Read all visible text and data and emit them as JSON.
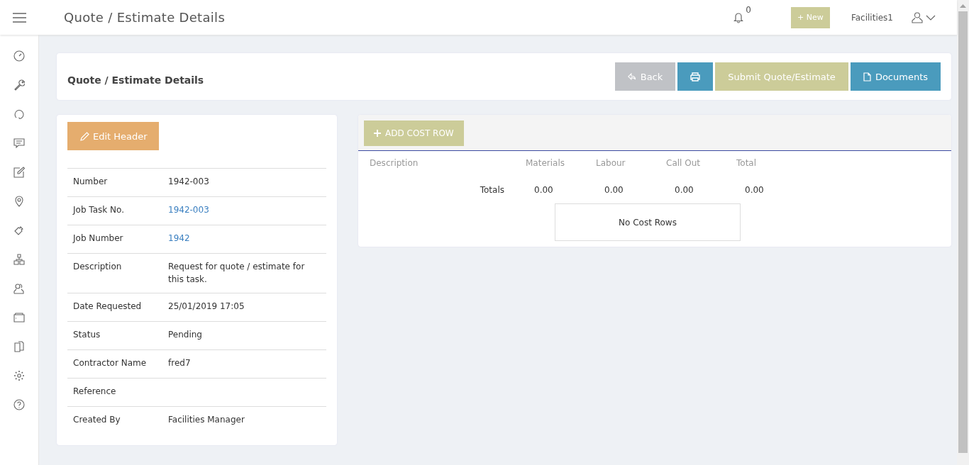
{
  "topbar": {
    "title": "Quote / Estimate Details",
    "notification_count": "0",
    "new_button": "+ New",
    "user_name": "Facilities1"
  },
  "header": {
    "title": "Quote / Estimate Details",
    "buttons": [
      {
        "kind": "back",
        "label": "Back"
      },
      {
        "kind": "print"
      },
      {
        "kind": "submit",
        "label": "Submit Quote/Estimate"
      },
      {
        "kind": "documents",
        "label": "Documents"
      }
    ]
  },
  "details": {
    "edit_button": "Edit Header",
    "rows": [
      {
        "label": "Number",
        "value": "1942-003",
        "kind": "text"
      },
      {
        "label": "Job Task No.",
        "value": "1942-003",
        "kind": "link"
      },
      {
        "label": "Job Number",
        "value": "1942",
        "kind": "link"
      },
      {
        "label": "Description",
        "value": "Request for quote / estimate for this task.",
        "kind": "text"
      },
      {
        "label": "Date Requested",
        "value": "25/01/2019 17:05",
        "kind": "text"
      },
      {
        "label": "Status",
        "value": "Pending",
        "kind": "text"
      },
      {
        "label": "Contractor Name",
        "value": "fred7",
        "kind": "text"
      },
      {
        "label": "Reference"
      },
      {
        "label": "Created By",
        "value": "Facilities Manager",
        "kind": "text"
      }
    ]
  },
  "costs": {
    "add_button": "ADD COST ROW",
    "columns": [
      "Description",
      "Materials",
      "Labour",
      "Call Out",
      "Total"
    ],
    "totals_label": "Totals",
    "totals": [
      "0.00",
      "0.00",
      "0.00",
      "0.00"
    ],
    "empty_message": "No Cost Rows"
  }
}
